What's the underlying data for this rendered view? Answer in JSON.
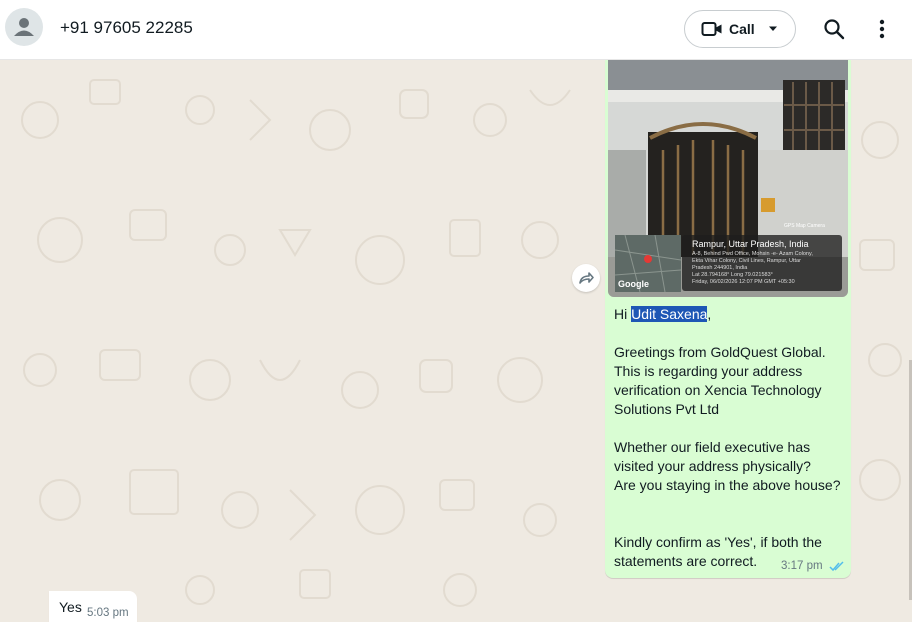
{
  "header": {
    "contact_name": "+91 97605 22285",
    "call_label": "Call",
    "icons": [
      "default-avatar-icon",
      "video-camera-icon",
      "chevron-down-icon",
      "search-icon",
      "more-vert-icon"
    ]
  },
  "outgoing": {
    "photo": {
      "gps_title": "Rampur, Uttar Pradesh, India",
      "address_lines": [
        "A-8, Behind Pwd Office, Mohsin -e- Azam Colony,",
        "Ekta Vihar Colony, Civil Lines, Rampur, Uttar",
        "Pradesh 244901, India",
        "Lat 28.794168° Long 79.021583°",
        "Friday, 06/02/2026 12:07 PM GMT +05:30"
      ],
      "camera_app": "GPS Map Camera",
      "map_brand": "Google"
    },
    "greeting_prefix": "Hi ",
    "name_highlight": "Udit Saxena",
    "greeting_suffix": ",",
    "lines": [
      "Greetings from GoldQuest Global.",
      "This is regarding your address",
      "verification on Xencia Technology",
      "Solutions Pvt Ltd",
      "Whether our field executive has",
      "visited your address physically?",
      "Are you staying in the above house?",
      "Kindly confirm as 'Yes', if both the",
      "statements are correct."
    ],
    "time": "3:17 pm",
    "status": "read",
    "tick_color": "#53bdeb"
  },
  "incoming": {
    "text": "Yes",
    "time": "5:03 pm"
  },
  "colors": {
    "chat_bg": "#efeae2",
    "outgoing_bubble": "#d9fdd3",
    "incoming_bubble": "#ffffff",
    "highlight": "#1e57b5"
  }
}
